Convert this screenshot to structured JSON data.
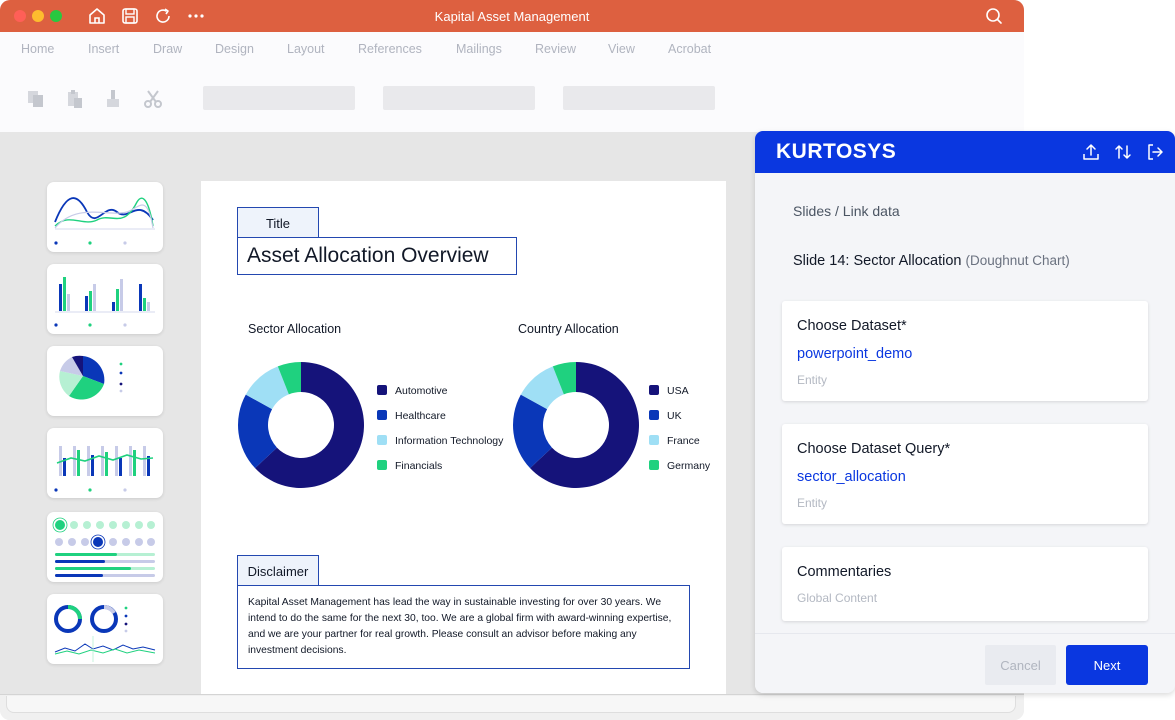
{
  "window": {
    "title": "Kapital Asset Management"
  },
  "ribbon": {
    "tabs": [
      "Home",
      "Insert",
      "Draw",
      "Design",
      "Layout",
      "References",
      "Mailings",
      "Review",
      "View",
      "Acrobat"
    ]
  },
  "colors": {
    "navy": "#15137a",
    "blue": "#0a37b8",
    "light_blue": "#9fdff5",
    "green": "#1fd17f",
    "accent": "#0a37e0",
    "titlebar": "#dd6040"
  },
  "slide": {
    "title_tab": "Title",
    "title": "Asset Allocation Overview",
    "disclaimer_tab": "Disclaimer",
    "disclaimer_text": "Kapital Asset Management has lead the way in sustainable investing for over 30 years. We intend to do the same for the next 30, too. We are a global firm with award-winning expertise, and we are your partner for real growth. Please consult an advisor before making any investment decisions."
  },
  "chart_data": [
    {
      "type": "pie",
      "title": "Sector Allocation",
      "categories": [
        "Automotive",
        "Healthcare",
        "Information Technology",
        "Financials"
      ],
      "values": [
        63,
        20,
        11,
        6
      ],
      "colors": [
        "#15137a",
        "#0a37b8",
        "#9fdff5",
        "#1fd17f"
      ],
      "legend": "right"
    },
    {
      "type": "pie",
      "title": "Country Allocation",
      "categories": [
        "USA",
        "UK",
        "France",
        "Germany"
      ],
      "values": [
        63,
        20,
        11,
        6
      ],
      "colors": [
        "#15137a",
        "#0a37b8",
        "#9fdff5",
        "#1fd17f"
      ],
      "legend": "right"
    }
  ],
  "panel": {
    "logo": "KURTOSYS",
    "breadcrumb": "Slides / Link data",
    "slide_info": "Slide 14: Sector Allocation",
    "slide_info_sub": "(Doughnut Chart)",
    "cards": [
      {
        "title": "Choose Dataset*",
        "value": "powerpoint_demo",
        "sub": "Entity"
      },
      {
        "title": "Choose Dataset Query*",
        "value": "sector_allocation",
        "sub": "Entity"
      },
      {
        "title": "Commentaries",
        "value": "",
        "sub": "Global Content"
      }
    ],
    "cancel_label": "Cancel",
    "next_label": "Next"
  }
}
